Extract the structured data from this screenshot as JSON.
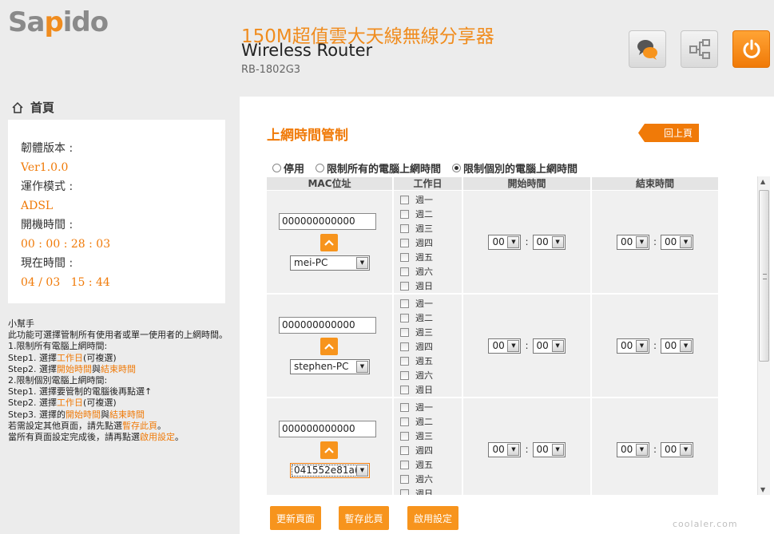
{
  "brand": {
    "logo": "Sapido",
    "product_cn": "150M超值雲大天線無線分享器",
    "product_en": "Wireless Router",
    "model": "RB-1802G3"
  },
  "header_buttons": [
    {
      "icon": "chat-icon"
    },
    {
      "icon": "network-icon"
    },
    {
      "icon": "power-icon"
    }
  ],
  "sidebar": {
    "home_label": "首頁",
    "info": [
      {
        "label": "韌體版本 :",
        "value": "Ver1.0.0"
      },
      {
        "label": "運作模式 :",
        "value": "ADSL"
      },
      {
        "label": "開機時間 :",
        "value": "00 : 00 : 28 : 03"
      },
      {
        "label": "現在時間 :",
        "value": "04 / 03   15 : 44"
      }
    ],
    "helper": {
      "title": "小幫手",
      "intro": "此功能可選擇管制所有使用者或單一使用者的上網時間。",
      "sec1": "1.限制所有電腦上網時間:",
      "s1_step1_a": "Step1. 選擇",
      "s1_step1_hl": "工作日",
      "s1_step1_b": "(可複選)",
      "s1_step2_a": "Step2. 選擇",
      "s1_step2_hl1": "開始時間",
      "s1_step2_mid": "與",
      "s1_step2_hl2": "結束時間",
      "sec2": "2.限制個別電腦上網時間:",
      "s2_step1": "Step1. 選擇要管制的電腦後再點選↑",
      "s2_step2_a": "Step2. 選擇",
      "s2_step2_hl": "工作日",
      "s2_step2_b": "(可複選)",
      "s2_step3_a": "Step3. 選擇的",
      "s2_step3_hl1": "開始時間",
      "s2_step3_mid": "與",
      "s2_step3_hl2": "結束時間",
      "note1_a": "若需設定其他頁面，請先點選",
      "note1_hl": "暫存此頁",
      "note1_b": "。",
      "note2_a": "當所有頁面設定完成後，請再點選",
      "note2_hl": "啟用設定",
      "note2_b": "。"
    }
  },
  "main": {
    "title": "上網時間管制",
    "back_label": "回上頁",
    "modes": [
      {
        "label": "停用",
        "selected": false
      },
      {
        "label": "限制所有的電腦上網時間",
        "selected": false
      },
      {
        "label": "限制個別的電腦上網時間",
        "selected": true
      }
    ],
    "columns": [
      "MAC位址",
      "工作日",
      "開始時間",
      "結束時間"
    ],
    "rows": [
      {
        "mac": "000000000000",
        "pc": "mei-PC",
        "start_h": "00",
        "start_m": "00",
        "end_h": "00",
        "end_m": "00"
      },
      {
        "mac": "000000000000",
        "pc": "stephen-PC",
        "start_h": "00",
        "start_m": "00",
        "end_h": "00",
        "end_m": "00"
      },
      {
        "mac": "000000000000",
        "pc": "041552e81a(",
        "start_h": "00",
        "start_m": "00",
        "end_h": "00",
        "end_m": "00"
      }
    ],
    "days": [
      "週一",
      "週二",
      "週三",
      "週四",
      "週五",
      "週六",
      "週日"
    ],
    "time_sep": ":",
    "buttons": {
      "refresh": "更新頁面",
      "save": "暫存此頁",
      "apply": "啟用設定"
    }
  },
  "watermark": "coolaler.com",
  "colors": {
    "accent": "#f07a08",
    "button": "#f7941d"
  }
}
